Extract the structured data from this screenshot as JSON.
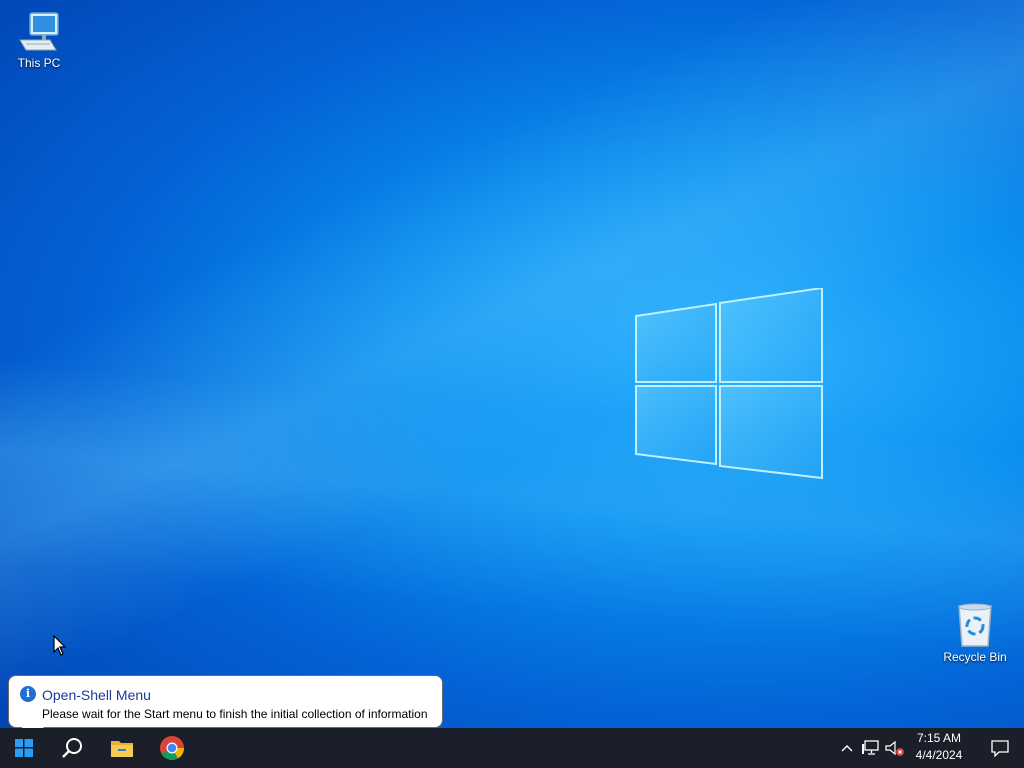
{
  "desktop": {
    "icons": [
      {
        "label": "This PC",
        "icon": "computer-icon"
      },
      {
        "label": "Recycle Bin",
        "icon": "recycle-bin-icon"
      }
    ],
    "wallpaper": "windows-10-logo"
  },
  "balloon": {
    "title": "Open-Shell Menu",
    "message": "Please wait for the Start menu to finish the initial collection of information",
    "icon": "info-icon"
  },
  "taskbar": {
    "buttons": [
      {
        "name": "start",
        "icon": "windows-start-icon"
      },
      {
        "name": "search",
        "icon": "search-icon"
      },
      {
        "name": "file-explorer",
        "icon": "folder-icon"
      },
      {
        "name": "chrome",
        "icon": "chrome-icon"
      }
    ],
    "tray": {
      "icons": [
        "chevron-up-icon",
        "network-icon",
        "volume-muted-icon"
      ],
      "time": "7:15 AM",
      "date": "4/4/2024"
    }
  },
  "colors": {
    "taskbar": "#1b1f2a",
    "accent": "#0078d7",
    "balloon_title": "#1c3c96"
  }
}
